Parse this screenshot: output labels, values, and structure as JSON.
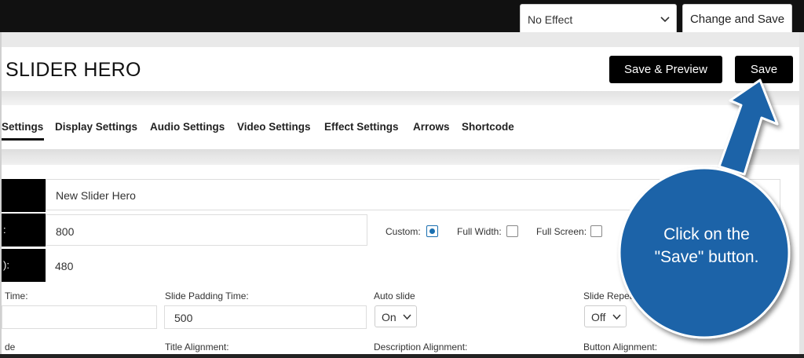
{
  "topbar": {
    "effect_select_value": "No Effect",
    "change_save_label": "Change and Save"
  },
  "header": {
    "title": "SLIDER HERO",
    "save_preview_label": "Save & Preview",
    "save_label": "Save"
  },
  "tabs": [
    {
      "label": "Settings"
    },
    {
      "label": "Display Settings"
    },
    {
      "label": "Audio Settings"
    },
    {
      "label": "Video Settings"
    },
    {
      "label": "Effect Settings"
    },
    {
      "label": "Arrows"
    },
    {
      "label": "Shortcode"
    }
  ],
  "form": {
    "rows": [
      {
        "label": "",
        "value": "New Slider Hero"
      },
      {
        "label": ":",
        "value": "800"
      },
      {
        "label": "):",
        "value": "480"
      }
    ],
    "size_options": [
      {
        "label": "Custom:",
        "checked": true
      },
      {
        "label": "Full Width:",
        "checked": false
      },
      {
        "label": "Full Screen:",
        "checked": false
      }
    ],
    "col_labels": [
      "Time:",
      "Slide Padding Time:",
      "Auto slide",
      "Slide Repeat"
    ],
    "slide_padding_value": "500",
    "auto_slide_value": "On",
    "slide_repeat_value": "Off",
    "align_labels": [
      "de",
      "Title Alignment:",
      "Description Alignment:",
      "Button Alignment:"
    ]
  },
  "callout": {
    "text": "Click on the \"Save\" button.",
    "color": "#1a64a8"
  }
}
